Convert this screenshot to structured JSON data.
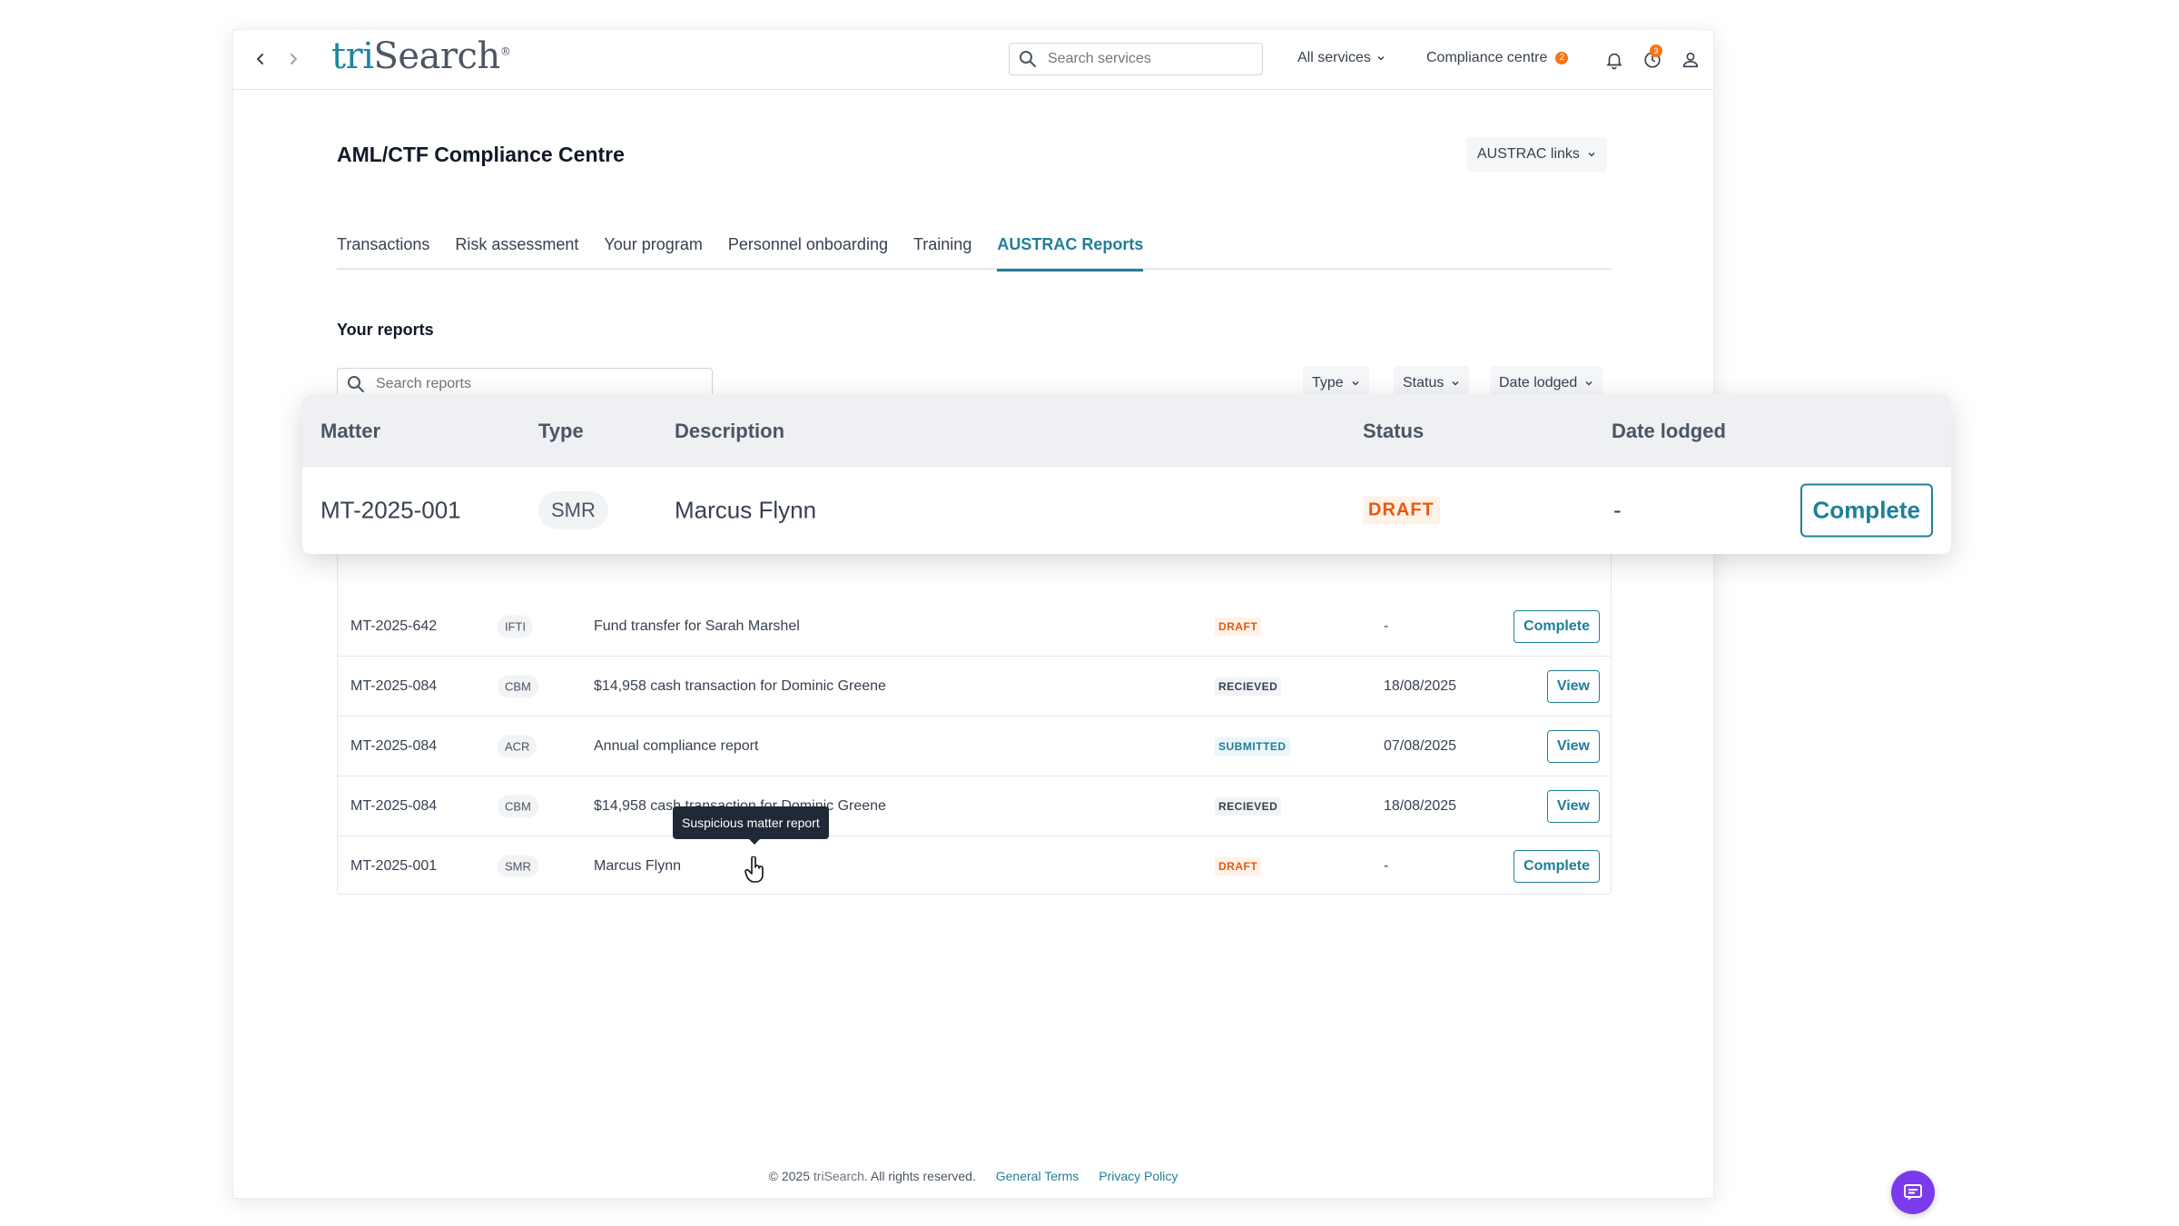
{
  "header": {
    "logo_tri": "tri",
    "logo_search": "Search",
    "logo_mark": "®",
    "search_placeholder": "Search services",
    "all_services": "All services",
    "compliance_centre": "Compliance centre",
    "compliance_badge": "2",
    "history_badge": "3"
  },
  "page": {
    "title": "AML/CTF Compliance Centre",
    "austrac_links": "AUSTRAC links",
    "tabs": [
      {
        "label": "Transactions",
        "active": false
      },
      {
        "label": "Risk assessment",
        "active": false
      },
      {
        "label": "Your program",
        "active": false
      },
      {
        "label": "Personnel onboarding",
        "active": false
      },
      {
        "label": "Training",
        "active": false
      },
      {
        "label": "AUSTRAC Reports",
        "active": true
      }
    ],
    "section_title": "Your reports",
    "search_reports_placeholder": "Search reports",
    "filters": {
      "type": "Type",
      "status": "Status",
      "date_lodged": "Date lodged"
    }
  },
  "zoom": {
    "columns": {
      "matter": "Matter",
      "type": "Type",
      "description": "Description",
      "status": "Status",
      "date_lodged": "Date lodged"
    },
    "row": {
      "matter": "MT-2025-001",
      "type": "SMR",
      "description": "Marcus Flynn",
      "status": "DRAFT",
      "date": "-",
      "action": "Complete"
    }
  },
  "reports": [
    {
      "matter": "MT-2025-642",
      "type": "IFTI",
      "description": "Fund transfer for Sarah Marshel",
      "status": "DRAFT",
      "status_kind": "draft",
      "date": "-",
      "action": "Complete"
    },
    {
      "matter": "MT-2025-084",
      "type": "CBM",
      "description": "$14,958 cash transaction for Dominic Greene",
      "status": "RECIEVED",
      "status_kind": "recieved",
      "date": "18/08/2025",
      "action": "View"
    },
    {
      "matter": "MT-2025-084",
      "type": "ACR",
      "description": "Annual compliance report",
      "status": "SUBMITTED",
      "status_kind": "submitted",
      "date": "07/08/2025",
      "action": "View"
    },
    {
      "matter": "MT-2025-084",
      "type": "CBM",
      "description": "$14,958 cash transaction for Dominic Greene",
      "status": "RECIEVED",
      "status_kind": "recieved",
      "date": "18/08/2025",
      "action": "View"
    },
    {
      "matter": "MT-2025-001",
      "type": "SMR",
      "description": "Marcus Flynn",
      "status": "DRAFT",
      "status_kind": "draft",
      "date": "-",
      "action": "Complete"
    }
  ],
  "tooltip": "Suspicious matter report",
  "footer": {
    "copyright_prefix": "© 2025",
    "brand": "triSearch",
    "copyright_suffix": ". All rights reserved.",
    "general_terms": "General Terms",
    "privacy_policy": "Privacy Policy"
  },
  "colors": {
    "accent": "#1f7f9a",
    "draft": "#ea580c",
    "chat": "#7c3aed"
  },
  "icons": [
    "chevron-left-icon",
    "chevron-right-icon",
    "search-icon",
    "bell-icon",
    "history-icon",
    "user-icon",
    "chat-icon"
  ]
}
